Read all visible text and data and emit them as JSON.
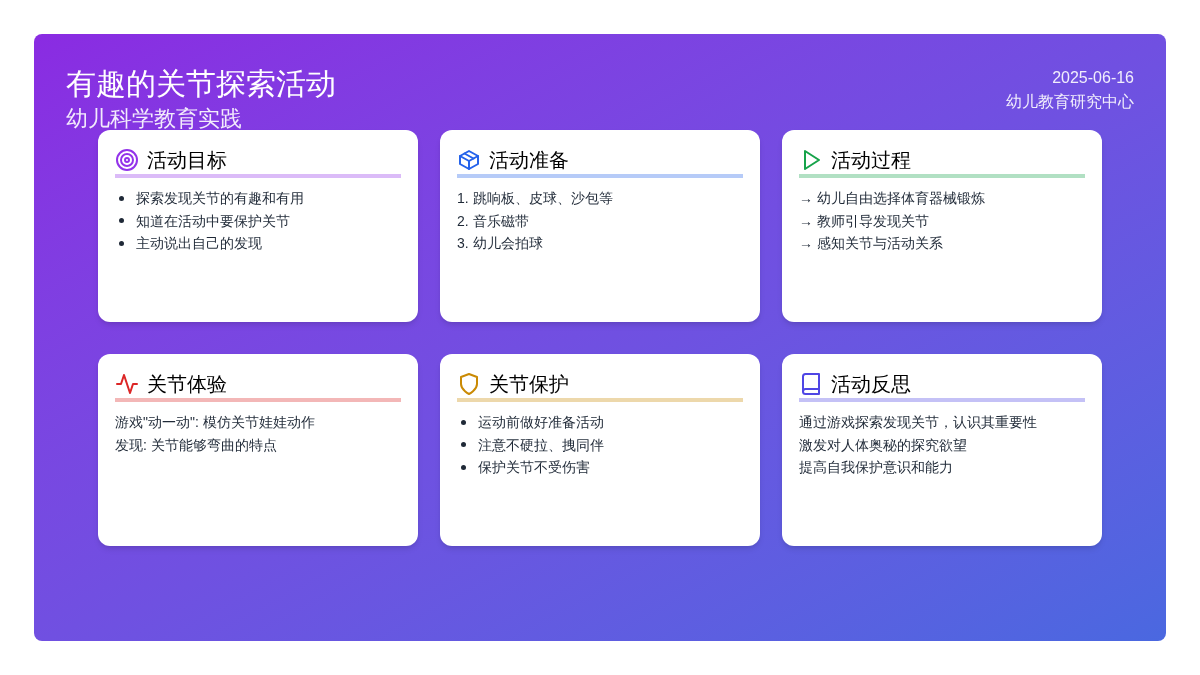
{
  "header": {
    "title": "有趣的关节探索活动",
    "subtitle": "幼儿科学教育实践",
    "date": "2025-06-16",
    "organization": "幼儿教育研究中心"
  },
  "cards": [
    {
      "title": "活动目标",
      "color": "#9333ea",
      "kind": "bullet",
      "items": [
        "探索发现关节的有趣和有用",
        "知道在活动中要保护关节",
        "主动说出自己的发现"
      ]
    },
    {
      "title": "活动准备",
      "color": "#2563eb",
      "kind": "numbered",
      "items": [
        "1. 跳响板、皮球、沙包等",
        "2. 音乐磁带",
        "3. 幼儿会拍球"
      ]
    },
    {
      "title": "活动过程",
      "color": "#16a34a",
      "kind": "plain",
      "items": [
        "→ 幼儿自由选择体育器械锻炼",
        "→ 教师引导发现关节",
        "→ 感知关节与活动关系"
      ]
    },
    {
      "title": "关节体验",
      "color": "#dc2626",
      "kind": "plain",
      "items": [
        "游戏\"动一动\": 模仿关节娃娃动作",
        "发现: 关节能够弯曲的特点"
      ]
    },
    {
      "title": "关节保护",
      "color": "#ca8a04",
      "kind": "bullet",
      "items": [
        "运动前做好准备活动",
        "注意不硬拉、拽同伴",
        "保护关节不受伤害"
      ]
    },
    {
      "title": "活动反思",
      "color": "#4f46e5",
      "kind": "plain",
      "items": [
        "通过游戏探索发现关节，认识其重要性",
        "激发对人体奥秘的探究欲望",
        "提高自我保护意识和能力"
      ]
    }
  ]
}
